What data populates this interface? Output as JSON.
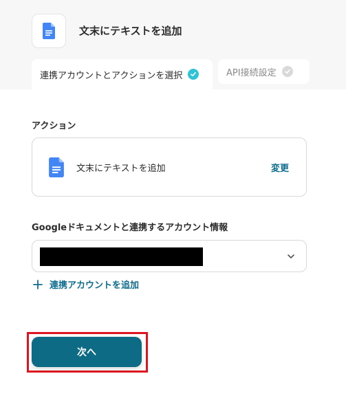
{
  "header": {
    "title": "文末にテキストを追加",
    "app_icon": "google-docs-icon"
  },
  "tabs": [
    {
      "label": "連携アカウントとアクションを選択",
      "state": "done"
    },
    {
      "label": "API接続設定",
      "state": "pending"
    }
  ],
  "action_section": {
    "label": "アクション",
    "action_name": "文末にテキストを追加",
    "change_label": "変更"
  },
  "account_section": {
    "label": "Googleドキュメントと連携するアカウント情報",
    "selected_value_redacted": true,
    "add_label": "連携アカウントを追加"
  },
  "next_button": {
    "label": "次へ",
    "highlighted": true
  },
  "colors": {
    "accent": "#0e6b85",
    "link": "#0f6d8e",
    "check_done": "#2ec4d6",
    "highlight": "#e0141e",
    "docs_blue": "#4285f4"
  }
}
